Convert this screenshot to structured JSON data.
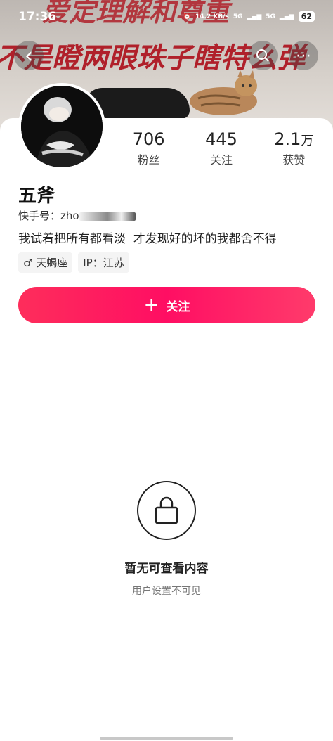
{
  "status_bar": {
    "time": "17:36",
    "speed": "14.2 KB/s",
    "signal_1": "5G",
    "signal_2": "5G",
    "battery": "62"
  },
  "cover": {
    "graffiti_line1": "爱定理解和尊重",
    "graffiti_line2": "不是瞪两眼珠子瞎特么弹"
  },
  "nav": {
    "back_icon": "‹",
    "search_icon": "⌕",
    "more_icon": "⋯"
  },
  "profile": {
    "name": "五斧",
    "id_label": "快手号：zho",
    "bio": "我试着把所有都看淡  才发现好的坏的我都舍不得",
    "tags": [
      {
        "label": "♂ 天蝎座"
      },
      {
        "label": "IP：江苏"
      }
    ]
  },
  "stats": [
    {
      "value": "706",
      "unit": "",
      "label": "粉丝"
    },
    {
      "value": "445",
      "unit": "",
      "label": "关注"
    },
    {
      "value": "2.1",
      "unit": "万",
      "label": "获赞"
    }
  ],
  "follow_button": {
    "label": "关注",
    "icon": "+"
  },
  "empty_state": {
    "title": "暂无可查看内容",
    "subtitle": "用户设置不可见",
    "icon": "lock-icon"
  },
  "colors": {
    "accent": "#fe2d5b",
    "graffiti": "#b0202a"
  }
}
